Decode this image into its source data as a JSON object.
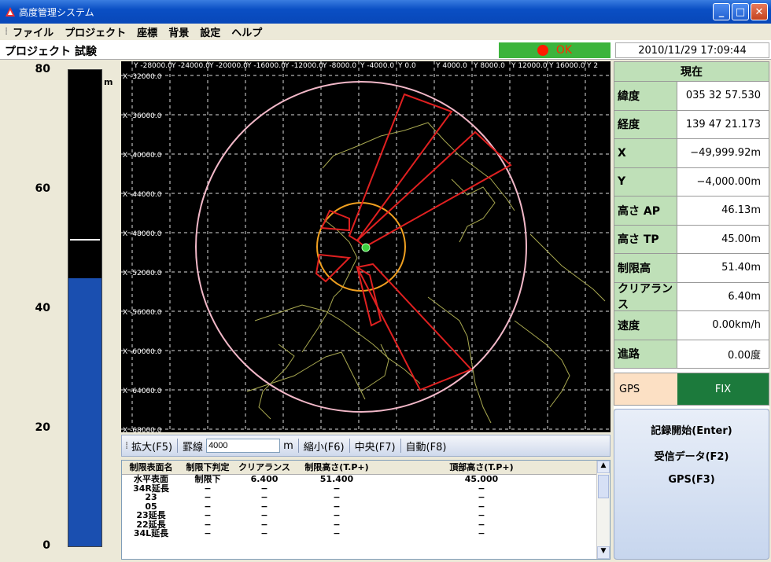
{
  "window": {
    "title": "高度管理システム"
  },
  "menu": [
    "ファイル",
    "プロジェクト",
    "座標",
    "背景",
    "設定",
    "ヘルプ"
  ],
  "project_label": "プロジェクト  試験",
  "status": {
    "text": "OK",
    "color": "#3cb43c"
  },
  "datetime": "2010/11/29 17:09:44",
  "gauge": {
    "unit": "m",
    "ticks": [
      "80",
      "60",
      "40",
      "20",
      "0"
    ],
    "max": 80,
    "current_height": 45.0,
    "limit_height": 51.4
  },
  "plot": {
    "y_labels": [
      "Y -28000.0",
      "Y -24000.0",
      "Y -20000.0",
      "Y -16000.0",
      "Y -12000.0",
      "Y -8000.0",
      "Y -4000.0",
      "Y 0.0",
      "Y 4000.0",
      "Y 8000.0",
      "Y 12000.0",
      "Y 16000.0",
      "Y 2"
    ],
    "x_labels": [
      "X -32000.0",
      "X -36000.0",
      "X -40000.0",
      "X -44000.0",
      "X -48000.0",
      "X -52000.0",
      "X -56000.0",
      "X -60000.0",
      "X -64000.0",
      "X -68000.0"
    ]
  },
  "toolbar": {
    "zoom_in": "拡大(F5)",
    "grid_label": "罫線",
    "grid_value": "4000",
    "grid_unit": "m",
    "zoom_out": "縮小(F6)",
    "center": "中央(F7)",
    "auto": "自動(F8)"
  },
  "table": {
    "headers": [
      "制限表面名",
      "制限下判定",
      "クリアランス",
      "制限高さ(T.P+)",
      "頂部高さ(T.P+)"
    ],
    "rows": [
      [
        "水平表面",
        "制限下",
        "6.400",
        "51.400",
        "45.000"
      ],
      [
        "34R延長",
        "−",
        "−",
        "−",
        "−"
      ],
      [
        "23",
        "−",
        "−",
        "−",
        "−"
      ],
      [
        "05",
        "−",
        "−",
        "−",
        "−"
      ],
      [
        "23延長",
        "−",
        "−",
        "−",
        "−"
      ],
      [
        "22延長",
        "−",
        "−",
        "−",
        "−"
      ],
      [
        "34L延長",
        "−",
        "−",
        "−",
        "−"
      ]
    ]
  },
  "current": {
    "title": "現在",
    "rows": [
      {
        "label": "緯度",
        "value": "035 32 57.530"
      },
      {
        "label": "経度",
        "value": "139 47 21.173"
      },
      {
        "label": "X",
        "value": "−49,999.92m"
      },
      {
        "label": "Y",
        "value": "−4,000.00m"
      },
      {
        "label": "高さ AP",
        "value": "46.13m"
      },
      {
        "label": "高さ TP",
        "value": "45.00m"
      },
      {
        "label": "制限高",
        "value": "51.40m"
      },
      {
        "label": "クリアランス",
        "value": "6.40m"
      },
      {
        "label": "速度",
        "value": "0.00km/h"
      },
      {
        "label": "進路",
        "value": "0.00度"
      }
    ]
  },
  "gps": {
    "label": "GPS",
    "value": "FIX"
  },
  "actions": [
    "記録開始(Enter)",
    "受信データ(F2)",
    "GPS(F3)"
  ]
}
